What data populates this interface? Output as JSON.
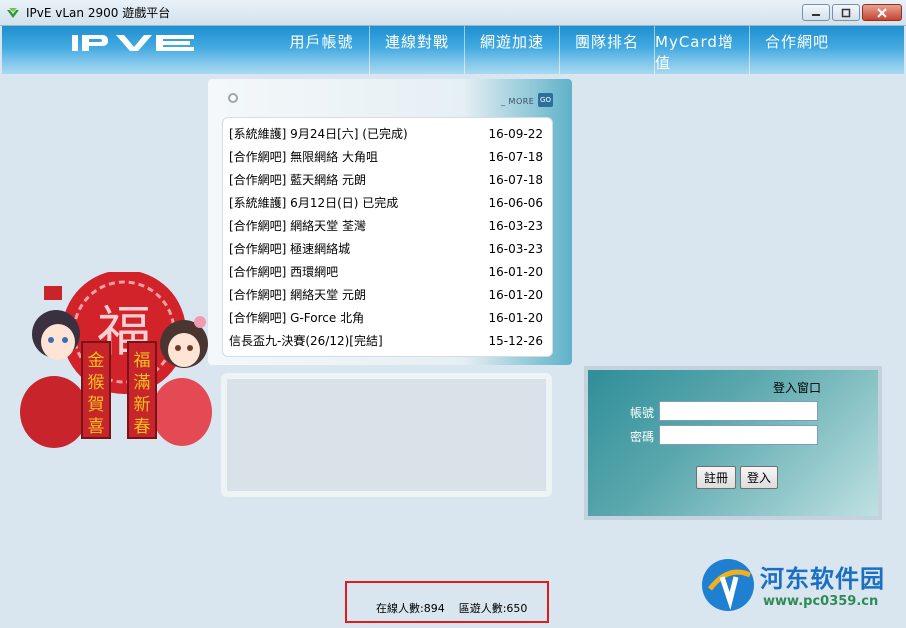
{
  "window": {
    "title": "IPvE vLan 2900 遊戲平台",
    "controls": {
      "minimize": "minimize-icon",
      "maximize": "maximize-icon",
      "close": "close-icon"
    }
  },
  "nav": {
    "logo_text": "IPVE",
    "items": [
      {
        "label": "用戶帳號"
      },
      {
        "label": "連線對戰"
      },
      {
        "label": "網遊加速"
      },
      {
        "label": "團隊排名"
      },
      {
        "label": "MyCard增值"
      },
      {
        "label": "合作網吧"
      }
    ]
  },
  "notices": {
    "more_label": "_ MORE",
    "go_label": "GO",
    "items": [
      {
        "title": "[系統維護] 9月24日[六] (已完成)",
        "date": "16-09-22"
      },
      {
        "title": "[合作網吧] 無限網絡 大角咀",
        "date": "16-07-18"
      },
      {
        "title": "[合作網吧] 藍天網絡 元朗",
        "date": "16-07-18"
      },
      {
        "title": "[系統維護] 6月12日(日) 已完成",
        "date": "16-06-06"
      },
      {
        "title": "[合作網吧] 網絡天堂 荃灣",
        "date": "16-03-23"
      },
      {
        "title": "[合作網吧] 極速網絡城",
        "date": "16-03-23"
      },
      {
        "title": "[合作網吧] 西環網吧",
        "date": "16-01-20"
      },
      {
        "title": "[合作網吧] 網絡天堂 元朗",
        "date": "16-01-20"
      },
      {
        "title": "[合作網吧] G-Force 北角",
        "date": "16-01-20"
      },
      {
        "title": "信長盃九-決賽(26/12)[完結]",
        "date": "15-12-26"
      }
    ]
  },
  "mascot": {
    "banner_left": [
      "金",
      "猴",
      "賀",
      "喜"
    ],
    "banner_right": [
      "福",
      "滿",
      "新",
      "春"
    ],
    "center_glyph": "福"
  },
  "login": {
    "title": "登入窗口",
    "account_label": "帳號",
    "password_label": "密碼",
    "account_value": "",
    "password_value": "",
    "register_label": "註冊",
    "login_label": "登入"
  },
  "status": {
    "online_label": "在線人數:894",
    "game_label": "區遊人數:650"
  },
  "watermark": {
    "title": "河东软件园",
    "url": "www.pc0359.cn"
  },
  "colors": {
    "nav_blue": "#1e8fd0",
    "login_teal": "#2f8e99",
    "status_border": "#e01b1b"
  }
}
